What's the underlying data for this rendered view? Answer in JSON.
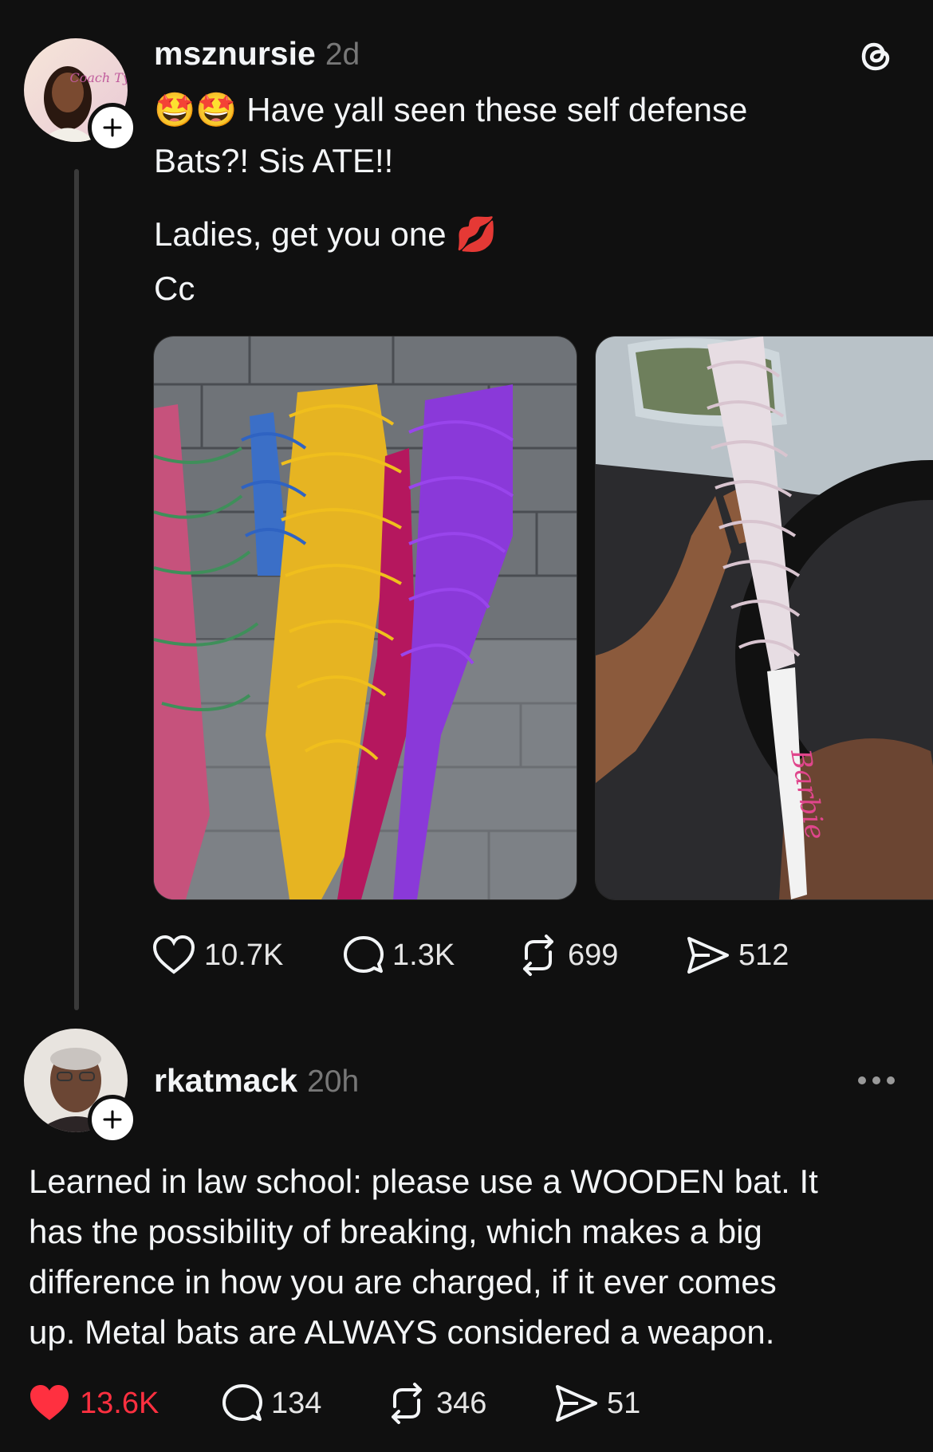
{
  "colors": {
    "background": "#101010",
    "text": "#f3f5f7",
    "muted": "#777777",
    "like_active": "#ff3040"
  },
  "post": {
    "username": "msznursie",
    "time": "2d",
    "line1": "🤩🤩 Have yall seen these self defense",
    "line2": "Bats?! Sis ATE!!",
    "line3": "Ladies, get you one 💋",
    "line4": "Cc",
    "avatar_text": "Coach Tye",
    "images": [
      {
        "icon": "colorful-barbed-wire-bats-photo"
      },
      {
        "icon": "pink-barbie-bat-in-car-photo",
        "bat_text": "Barbie"
      }
    ],
    "stats": {
      "likes": "10.7K",
      "comments": "1.3K",
      "reposts": "699",
      "shares": "512"
    },
    "menu_icon": "threads-logo-icon"
  },
  "reply": {
    "username": "rkatmack",
    "time": "20h",
    "lines": [
      "Learned in law school: please use a WOODEN bat. It",
      "has the possibility of breaking, which makes a big",
      "difference in how you are charged, if it ever comes",
      "up. Metal bats are ALWAYS considered a weapon."
    ],
    "stats": {
      "likes": "13.6K",
      "comments": "134",
      "reposts": "346",
      "shares": "51"
    },
    "liked": true,
    "menu_icon": "more-dots-icon"
  }
}
